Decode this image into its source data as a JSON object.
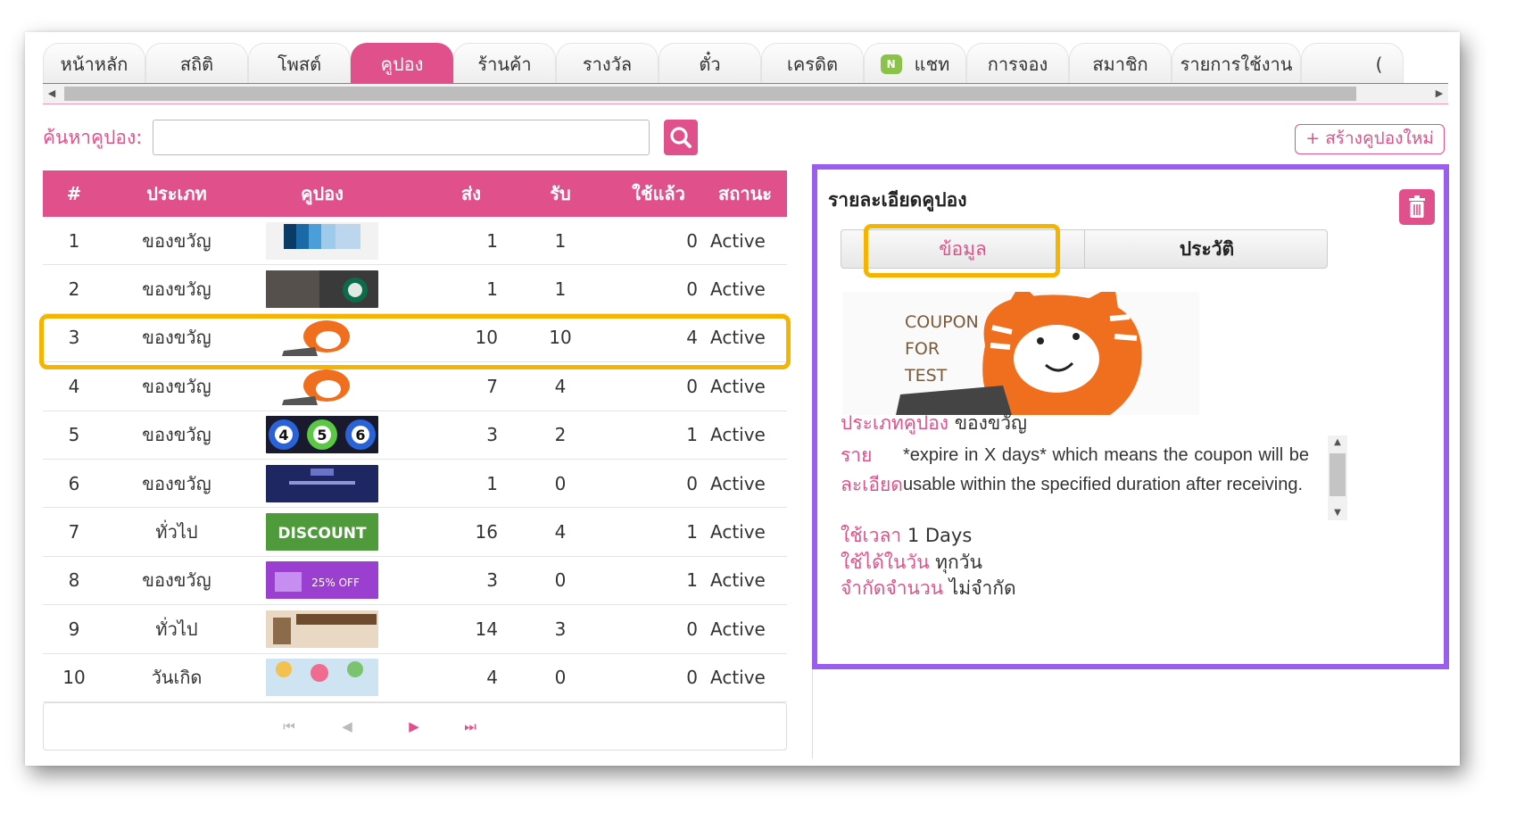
{
  "tabs": [
    {
      "label": "หน้าหลัก",
      "active": false
    },
    {
      "label": "สถิติ",
      "active": false
    },
    {
      "label": "โพสต์",
      "active": false
    },
    {
      "label": "คูปอง",
      "active": true
    },
    {
      "label": "ร้านค้า",
      "active": false
    },
    {
      "label": "รางวัล",
      "active": false
    },
    {
      "label": "ตั๋ว",
      "active": false
    },
    {
      "label": "เครดิต",
      "active": false
    },
    {
      "label": "แชท",
      "active": false,
      "icon": "chat-icon",
      "icon_text": "N"
    },
    {
      "label": "การจอง",
      "active": false
    },
    {
      "label": "สมาชิก",
      "active": false
    },
    {
      "label": "รายการใช้งาน",
      "active": false
    },
    {
      "label": "(",
      "active": false
    }
  ],
  "search": {
    "label": "ค้นหาคูปอง:",
    "value": "",
    "placeholder": ""
  },
  "create_button": "+ สร้างคูปองใหม่",
  "table": {
    "columns": [
      "#",
      "ประเภท",
      "คูปอง",
      "ส่ง",
      "รับ",
      "ใช้แล้ว",
      "สถานะ"
    ],
    "rows": [
      {
        "num": "1",
        "type": "ของขวัญ",
        "image": "pantone-swatches-image",
        "send": "1",
        "receive": "1",
        "used": "0",
        "status": "Active"
      },
      {
        "num": "2",
        "type": "ของขวัญ",
        "image": "coffee-shop-image",
        "send": "1",
        "receive": "1",
        "used": "0",
        "status": "Active"
      },
      {
        "num": "3",
        "type": "ของขวัญ",
        "image": "tiger-coupon-image",
        "send": "10",
        "receive": "10",
        "used": "4",
        "status": "Active"
      },
      {
        "num": "4",
        "type": "ของขวัญ",
        "image": "tiger-coupon-image",
        "send": "7",
        "receive": "4",
        "used": "0",
        "status": "Active"
      },
      {
        "num": "5",
        "type": "ของขวัญ",
        "image": "lottery-balls-image",
        "send": "3",
        "receive": "2",
        "used": "1",
        "status": "Active",
        "balls": [
          "4",
          "5",
          "6"
        ]
      },
      {
        "num": "6",
        "type": "ของขวัญ",
        "image": "logo-banner-image",
        "send": "1",
        "receive": "0",
        "used": "0",
        "status": "Active"
      },
      {
        "num": "7",
        "type": "ทั่วไป",
        "image": "discount-banner-image",
        "send": "16",
        "receive": "4",
        "used": "1",
        "status": "Active",
        "banner_text": "DISCOUNT"
      },
      {
        "num": "8",
        "type": "ของขวัญ",
        "image": "shopping-cart-image",
        "send": "3",
        "receive": "0",
        "used": "1",
        "status": "Active",
        "banner_text": "25% OFF"
      },
      {
        "num": "9",
        "type": "ทั่วไป",
        "image": "cosmetics-image",
        "send": "14",
        "receive": "3",
        "used": "0",
        "status": "Active"
      },
      {
        "num": "10",
        "type": "วันเกิด",
        "image": "birthday-image",
        "send": "4",
        "receive": "0",
        "used": "0",
        "status": "Active"
      }
    ]
  },
  "detail": {
    "title": "รายละเอียดคูปอง",
    "tabs": {
      "info": "ข้อมูล",
      "history": "ประวัติ"
    },
    "coupon_image_text": [
      "COUPON",
      "FOR",
      "TEST"
    ],
    "type_label": "ประเภทคูปอง",
    "type_value": "ของขวัญ",
    "desc_label": "รายละเอียด",
    "desc_value": "*expire in X days* which means the coupon will be usable within the specified duration after receiving.",
    "duration_label": "ใช้เวลา",
    "duration_value": "1 Days",
    "usable_label": "ใช้ได้ในวัน",
    "usable_value": "ทุกวัน",
    "limit_label": "จำกัดจำนวน",
    "limit_value": "ไม่จำกัด"
  },
  "colors": {
    "accent": "#e0508a",
    "highlight": "#f4b400",
    "panel_border": "#9b5cf0"
  }
}
